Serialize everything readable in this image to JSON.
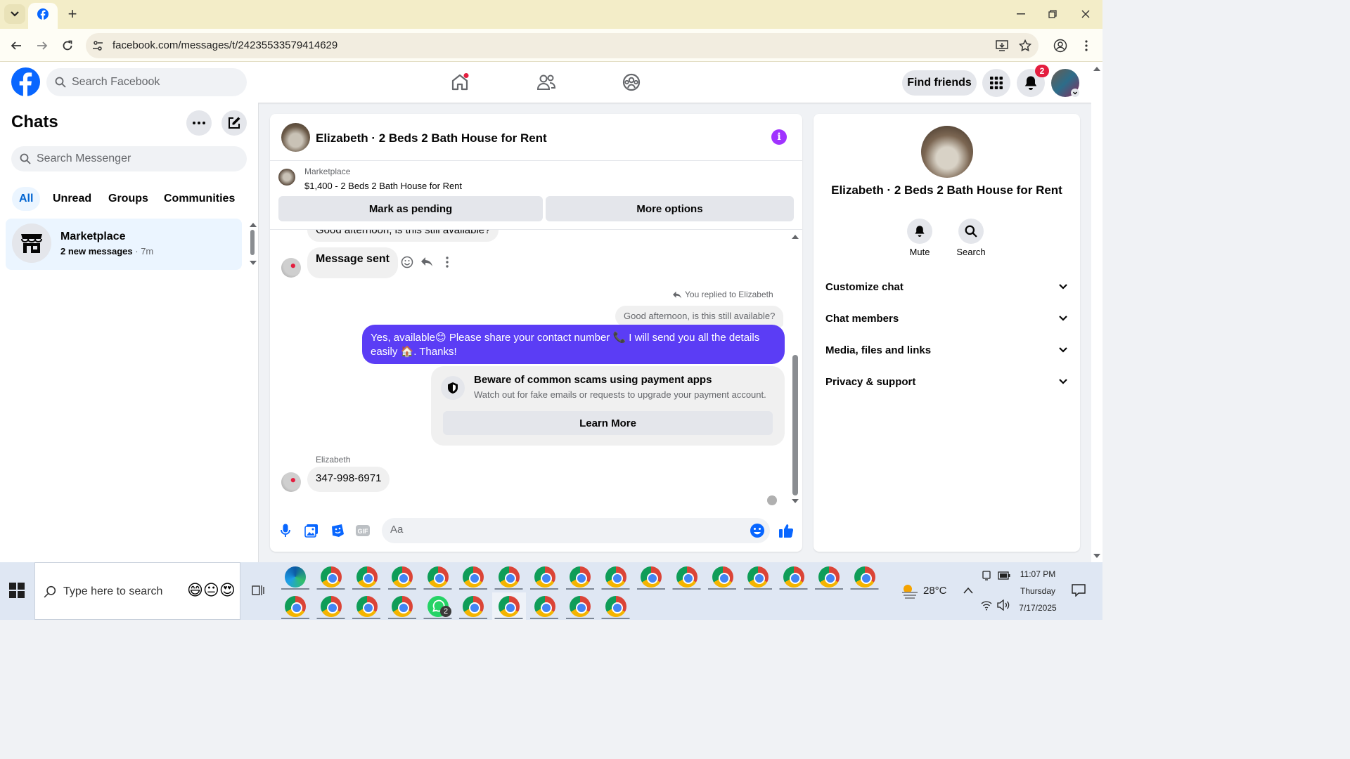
{
  "browser": {
    "url": "facebook.com/messages/t/24235533579414629",
    "new_tab": "+"
  },
  "header": {
    "search_placeholder": "Search Facebook",
    "find_friends": "Find friends",
    "notification_count": "2"
  },
  "left": {
    "title": "Chats",
    "search_placeholder": "Search Messenger",
    "filters": [
      "All",
      "Unread",
      "Groups",
      "Communities"
    ],
    "chat": {
      "name": "Marketplace",
      "preview": "2 new messages",
      "time": "7m"
    }
  },
  "conversation": {
    "title": "Elizabeth · 2 Beds 2 Bath House for Rent",
    "marketplace_label": "Marketplace",
    "listing": "$1,400 - 2 Beds 2 Bath House for Rent",
    "mark_pending": "Mark as pending",
    "more_options": "More options",
    "msg_partial": "Good afternoon, is this still available?",
    "msg_sent": "Message sent",
    "replied_label": "You replied to Elizabeth",
    "quoted": "Good afternoon, is this still available?",
    "reply_line1": "Yes, available😊 Please share your contact number 📞 I will send you all the details",
    "reply_line2": "easily 🏠. Thanks!",
    "scam_title": "Beware of common scams using payment apps",
    "scam_sub": "Watch out for fake emails or requests to upgrade your payment account.",
    "learn_more": "Learn More",
    "sender": "Elizabeth",
    "phone_msg": "347-998-6971",
    "composer_placeholder": "Aa"
  },
  "info": {
    "title": "Elizabeth · 2 Beds 2 Bath House for Rent",
    "mute": "Mute",
    "search": "Search",
    "sections": [
      "Customize chat",
      "Chat members",
      "Media, files and links",
      "Privacy & support"
    ]
  },
  "taskbar": {
    "search_placeholder": "Type here to search",
    "weather": "28°C",
    "time": "11:07 PM",
    "day": "Thursday",
    "date": "7/17/2025",
    "whatsapp_badge": "2"
  },
  "colors": {
    "fb_blue": "#0866ff",
    "outgoing_bubble": "#5b3df5",
    "active_chat": "#ebf5ff",
    "info_purple": "#a033ff",
    "badge_red": "#e41e3f"
  }
}
